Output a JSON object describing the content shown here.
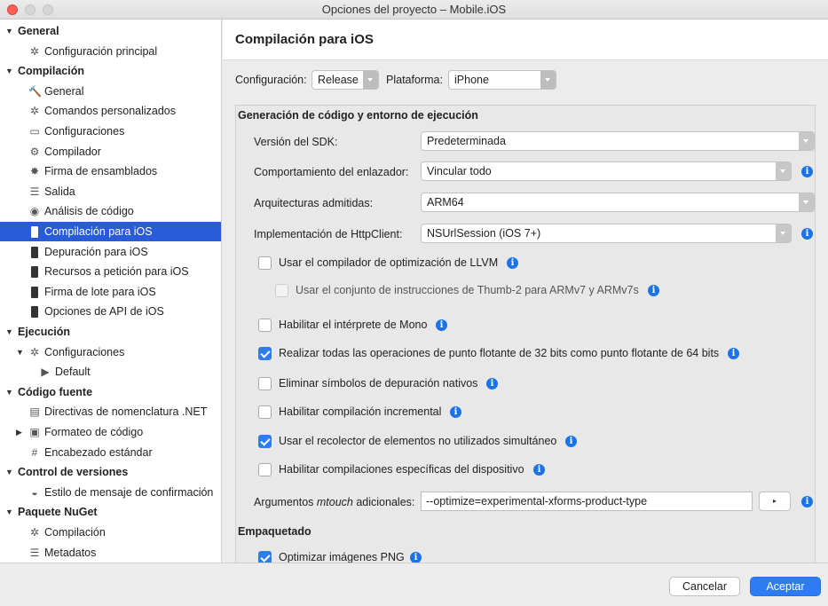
{
  "window": {
    "title": "Opciones del proyecto – Mobile.iOS"
  },
  "sidebar": {
    "items": [
      {
        "label": "General",
        "kind": "category",
        "arrow": "▼",
        "icon": ""
      },
      {
        "label": "Configuración principal",
        "kind": "item",
        "icon": "✲"
      },
      {
        "label": "Compilación",
        "kind": "category",
        "arrow": "▼",
        "icon": ""
      },
      {
        "label": "General",
        "kind": "item",
        "icon": "🔨"
      },
      {
        "label": "Comandos personalizados",
        "kind": "item",
        "icon": "✲"
      },
      {
        "label": "Configuraciones",
        "kind": "item",
        "icon": "▭"
      },
      {
        "label": "Compilador",
        "kind": "item",
        "icon": "⚙"
      },
      {
        "label": "Firma de ensamblados",
        "kind": "item",
        "icon": "✸"
      },
      {
        "label": "Salida",
        "kind": "item",
        "icon": "☰"
      },
      {
        "label": "Análisis de código",
        "kind": "item",
        "icon": "◉"
      },
      {
        "label": "Compilación para iOS",
        "kind": "item",
        "icon": "phone",
        "selected": true
      },
      {
        "label": "Depuración para iOS",
        "kind": "item",
        "icon": "phone"
      },
      {
        "label": "Recursos a petición para iOS",
        "kind": "item",
        "icon": "phone"
      },
      {
        "label": "Firma de lote para iOS",
        "kind": "item",
        "icon": "phone"
      },
      {
        "label": "Opciones de API de iOS",
        "kind": "item",
        "icon": "phone"
      },
      {
        "label": "Ejecución",
        "kind": "category",
        "arrow": "▼",
        "icon": ""
      },
      {
        "label": "Configuraciones",
        "kind": "subcat",
        "arrow": "▼",
        "icon": "✲"
      },
      {
        "label": "Default",
        "kind": "subitem",
        "icon": "▶"
      },
      {
        "label": "Código fuente",
        "kind": "category",
        "arrow": "▼",
        "icon": ""
      },
      {
        "label": "Directivas de nomenclatura .NET",
        "kind": "item",
        "icon": "▤"
      },
      {
        "label": "Formateo de código",
        "kind": "subcat-collapsed",
        "arrow": "▶",
        "icon": "▣"
      },
      {
        "label": "Encabezado estándar",
        "kind": "item",
        "icon": "#"
      },
      {
        "label": "Control de versiones",
        "kind": "category",
        "arrow": "▼",
        "icon": ""
      },
      {
        "label": "Estilo de mensaje de confirmación",
        "kind": "item",
        "icon": "◒"
      },
      {
        "label": "Paquete NuGet",
        "kind": "category",
        "arrow": "▼",
        "icon": ""
      },
      {
        "label": "Compilación",
        "kind": "item",
        "icon": "✲"
      },
      {
        "label": "Metadatos",
        "kind": "item",
        "icon": "☰"
      }
    ]
  },
  "main": {
    "title": "Compilación para iOS",
    "config_label": "Configuración:",
    "config_value": "Release",
    "platform_label": "Plataforma:",
    "platform_value": "iPhone",
    "section1_title": "Generación de código y entorno de ejecución",
    "rows": {
      "sdk_label": "Versión del SDK:",
      "sdk_value": "Predeterminada",
      "linker_label": "Comportamiento del enlazador:",
      "linker_value": "Vincular todo",
      "arch_label": "Arquitecturas admitidas:",
      "arch_value": "ARM64",
      "http_label": "Implementación de HttpClient:",
      "http_value": "NSUrlSession (iOS 7+)"
    },
    "checks": [
      {
        "label": "Usar el compilador de optimización de LLVM",
        "checked": false,
        "info": true
      },
      {
        "label": "Usar el conjunto de instrucciones de Thumb-2 para ARMv7 y ARMv7s",
        "checked": false,
        "info": true,
        "disabled": true
      },
      {
        "label": "Habilitar el intérprete de Mono",
        "checked": false,
        "info": true
      },
      {
        "label": "Realizar todas las operaciones de punto flotante de 32 bits como punto flotante de 64 bits",
        "checked": true,
        "info": true
      },
      {
        "label": "Eliminar símbolos de depuración nativos",
        "checked": false,
        "info": true
      },
      {
        "label": "Habilitar compilación incremental",
        "checked": false,
        "info": true
      },
      {
        "label": "Usar el recolector de elementos no utilizados simultáneo",
        "checked": true,
        "info": true
      },
      {
        "label": "Habilitar compilaciones específicas del dispositivo",
        "checked": false,
        "info": true
      }
    ],
    "mtouch_label_pre": "Argumentos ",
    "mtouch_label_em": "mtouch",
    "mtouch_label_post": " adicionales:",
    "mtouch_value": "--optimize=experimental-xforms-product-type",
    "mtouch_button": "▸",
    "section2_title": "Empaquetado",
    "section2_first_item": "Optimizar imágenes PNG"
  },
  "footer": {
    "cancel": "Cancelar",
    "accept": "Aceptar"
  },
  "colors": {
    "accent": "#2a5cd9",
    "primary_button": "#2d7cf6",
    "info": "#1a73e8"
  }
}
